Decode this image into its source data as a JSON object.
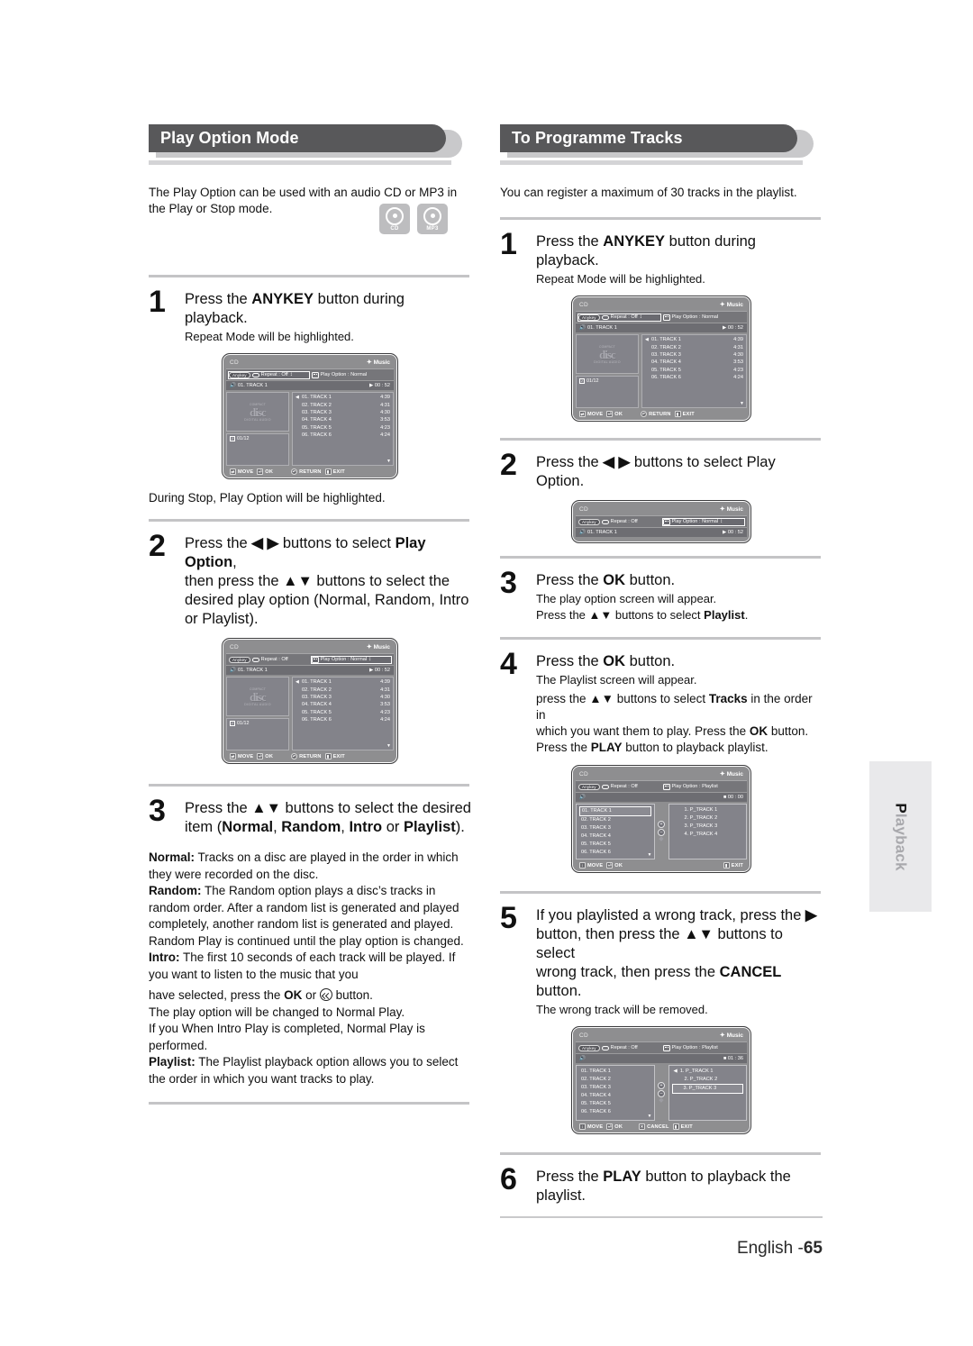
{
  "page": {
    "footer_language": "English -",
    "footer_page": "65",
    "side_tab_bold": "P",
    "side_tab_rest": "layback"
  },
  "left": {
    "banner_title": "Play Option Mode",
    "intro": "The Play Option can be used with an audio CD or MP3 in the Play or Stop mode.",
    "disc_icons": [
      {
        "name": "cd-disc-icon",
        "label": "CD"
      },
      {
        "name": "mp3-disc-icon",
        "label": "MP3"
      }
    ],
    "steps": [
      {
        "num": "1",
        "lead_a": "Press the ",
        "lead_b": "ANYKEY",
        "lead_c": " button during playback.",
        "sub": "Repeat Mode will be highlighted."
      },
      {
        "num": "2",
        "line1_a": "Press the ",
        "line1_arrows": "◀ ▶",
        "line1_b": " buttons to select ",
        "line1_bold": "Play Option",
        "line1_c": ",",
        "line2_a": "then press the ",
        "line2_arrows": "▲▼",
        "line2_b": " buttons to select the",
        "line3": "desired play option (Normal, Random, Intro",
        "line4": "or Playlist)."
      },
      {
        "num": "3",
        "line1_a": "Press the ",
        "line1_arrows": "▲▼",
        "line1_b": " buttons to select the desired",
        "line2_a": "item (",
        "line2_w1": "Normal",
        "line2_s1": ", ",
        "line2_w2": "Random",
        "line2_s2": ", ",
        "line2_w3": "Intro",
        "line2_s3": " or ",
        "line2_w4": "Playlist",
        "line2_s4": ")."
      }
    ],
    "note_after_step1": "During Stop, Play Option will be highlighted.",
    "definitions": [
      {
        "term": "Normal:",
        "text": " Tracks on a disc are played in the order in which they were recorded on the disc."
      },
      {
        "term": "Random:",
        "text": " The Random option plays a disc’s tracks in random order. After a random list is generated and played completely, another random list is generated and played. Random Play is continued until the play option is changed."
      },
      {
        "term": "Intro:",
        "text": " The first 10 seconds of each track will be played. If you want to listen to the music that you"
      }
    ],
    "intro_cont_a": "have selected, press the ",
    "intro_cont_ok": "OK",
    "intro_cont_b": " or ",
    "intro_cont_c": " button.",
    "intro_cont_line2": "The play option will be changed to Normal Play.",
    "intro_cont_line3": "If you When Intro Play is completed, Normal Play is performed.",
    "playlist_def_term": "Playlist:",
    "playlist_def_text": " The Playlist playback option allows you to select the order in which you want tracks to play."
  },
  "right": {
    "banner_title": "To Programme Tracks",
    "intro": "You can register a maximum of 30 tracks in the playlist.",
    "steps": [
      {
        "num": "1",
        "lead_a": "Press the ",
        "lead_b": "ANYKEY",
        "lead_c": " button during playback.",
        "sub": "Repeat Mode will be highlighted."
      },
      {
        "num": "2",
        "lead_a": "Press the ",
        "arrows": "◀ ▶",
        "lead_b": " buttons to select Play Option."
      },
      {
        "num": "3",
        "lead_a": "Press the ",
        "lead_b": "OK",
        "lead_c": " button.",
        "sub1": "The play option screen will appear.",
        "sub2_a": "Press the ",
        "sub2_arrows": "▲▼",
        "sub2_b": " buttons to select ",
        "sub2_bold": "Playlist",
        "sub2_c": "."
      },
      {
        "num": "4",
        "lead_a": "Press the ",
        "lead_b": "OK",
        "lead_c": " button.",
        "sub1": "The Playlist screen will appear.",
        "sub2_a": "press the ",
        "sub2_arrows": "▲▼",
        "sub2_b": " buttons to select ",
        "sub2_bold": "Tracks",
        "sub2_c": " in the order in",
        "sub3_a": "which you want them to play. Press the ",
        "sub3_bold": "OK",
        "sub3_b": " button.",
        "sub4_a": "Press the ",
        "sub4_bold": "PLAY",
        "sub4_b": " button to playback playlist."
      },
      {
        "num": "5",
        "line1_a": "If you playlisted a wrong track, press the ",
        "line1_arrow": "▶",
        "line2_a": "button, then press the ",
        "line2_arrows": "▲▼",
        "line2_b": " buttons to select",
        "line3_a": "wrong track, then press the ",
        "line3_bold": "CANCEL",
        "line4": "button.",
        "sub": "The wrong track will be removed."
      },
      {
        "num": "6",
        "lead_a": "Press the ",
        "lead_b": "PLAY",
        "lead_c": " button to playback the",
        "lead_d": "playlist."
      }
    ]
  },
  "osd": {
    "header_cd": "CD",
    "header_music": "Music",
    "anykey_label": "Anykey",
    "repeat_label": "Repeat : Off",
    "play_option_normal": "Play Option : Normal",
    "play_option_playlist": "Play Option : Playlist",
    "now_playing": "01. TRACK 1",
    "elapsed": "00 : 52",
    "elapsed_playlist_empty": "00 : 00",
    "elapsed_playlist_sel": "01 : 36",
    "disc_word": "disc",
    "disc_sup": "COMPACT",
    "disc_sub": "DIGITAL AUDIO",
    "track_counter": "01/12",
    "tracks": [
      {
        "no": "01. TRACK 1",
        "time": "4:39"
      },
      {
        "no": "02. TRACK 2",
        "time": "4:31"
      },
      {
        "no": "03. TRACK 3",
        "time": "4:30"
      },
      {
        "no": "04. TRACK 4",
        "time": "3:53"
      },
      {
        "no": "05. TRACK 5",
        "time": "4:23"
      },
      {
        "no": "06. TRACK 6",
        "time": "4:24"
      }
    ],
    "source_tracks": [
      "01. TRACK 1",
      "02. TRACK 2",
      "03. TRACK 3",
      "04. TRACK 4",
      "05. TRACK 5",
      "06. TRACK 6"
    ],
    "playlist_tracks": [
      "1. P_TRACK 1",
      "2. P_TRACK 2",
      "3. P_TRACK 3",
      "4. P_TRACK 4"
    ],
    "footer_move": "MOVE",
    "footer_ok": "OK",
    "footer_return": "RETURN",
    "footer_exit": "EXIT",
    "footer_cancel": "CANCEL"
  }
}
